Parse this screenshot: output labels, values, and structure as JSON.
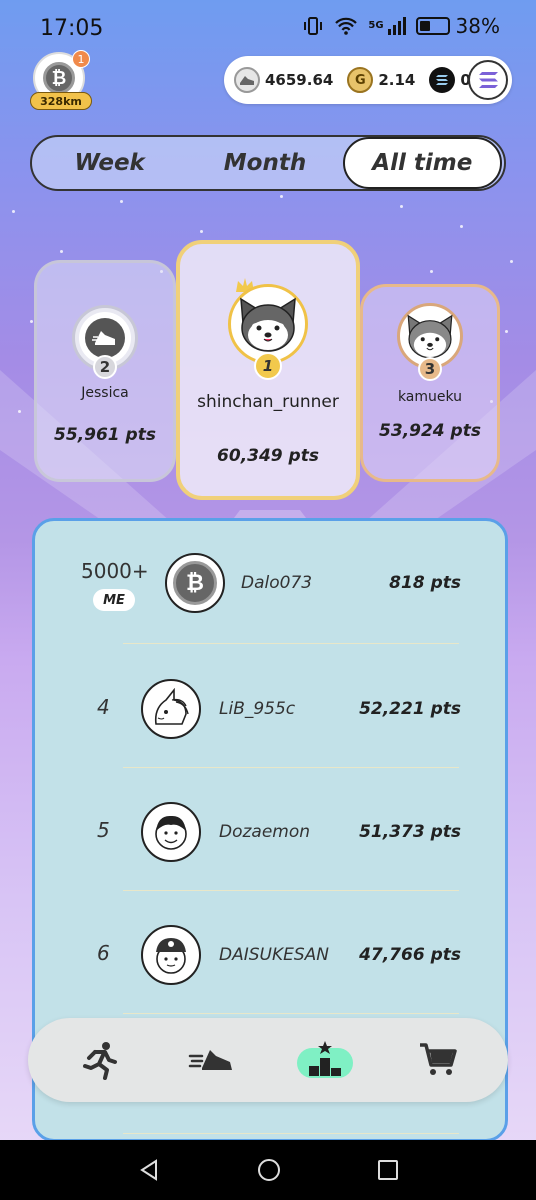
{
  "status_bar": {
    "time": "17:05",
    "network": "5G",
    "battery": "38%",
    "battery_level": 0.38
  },
  "header": {
    "profile": {
      "badge_count": "1",
      "distance": "328km"
    },
    "wallet": {
      "gmt_balance": "4659.64",
      "gst_balance": "2.14",
      "sol_balance": "0"
    }
  },
  "tabs": [
    {
      "label": "Week",
      "active": false
    },
    {
      "label": "Month",
      "active": false
    },
    {
      "label": "All time",
      "active": true
    }
  ],
  "podium": {
    "first": {
      "rank": "1",
      "name": "shinchan_runner",
      "points": "60,349 pts"
    },
    "second": {
      "rank": "2",
      "name": "Jessica",
      "points": "55,961 pts"
    },
    "third": {
      "rank": "3",
      "name": "kamueku",
      "points": "53,924 pts"
    }
  },
  "leaderboard": {
    "me": {
      "rank": "5000+",
      "badge": "ME",
      "name": "Dalo073",
      "points": "818 pts"
    },
    "rows": [
      {
        "rank": "4",
        "name": "LiB_955c",
        "points": "52,221 pts"
      },
      {
        "rank": "5",
        "name": "Dozaemon",
        "points": "51,373 pts"
      },
      {
        "rank": "6",
        "name": "DAISUKESAN",
        "points": "47,766 pts"
      }
    ]
  },
  "bottom_nav": [
    {
      "name": "run",
      "icon": "running-person-icon",
      "active": false
    },
    {
      "name": "sneakers",
      "icon": "sneaker-icon",
      "active": false
    },
    {
      "name": "leaderboard",
      "icon": "podium-icon",
      "active": true
    },
    {
      "name": "marketplace",
      "icon": "cart-icon",
      "active": false
    }
  ],
  "colors": {
    "accent": "#7ff0c4",
    "board_bg": "#c2e1e8",
    "gold": "#f0d07a",
    "bronze": "#e7b98a"
  }
}
